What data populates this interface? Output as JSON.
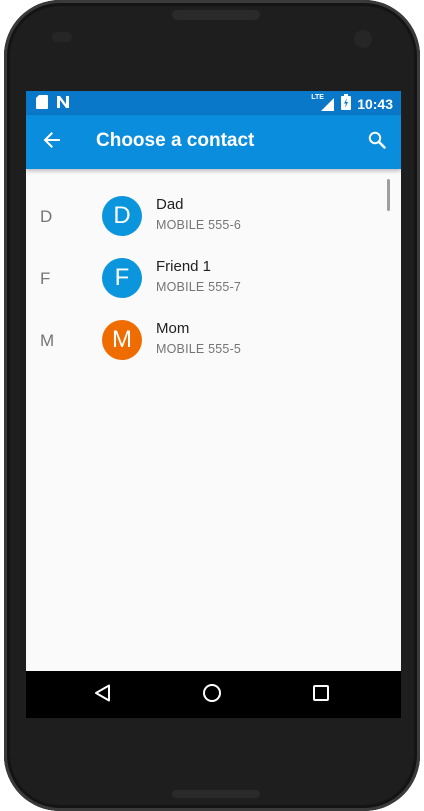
{
  "status_bar": {
    "time": "10:43",
    "network_label": "LTE",
    "left_icons": [
      "sd-card-icon",
      "nfc-n-icon"
    ],
    "right_icons": [
      "signal-icon",
      "battery-icon"
    ]
  },
  "app_bar": {
    "title": "Choose a contact",
    "back_icon": "arrow-back-icon",
    "search_icon": "search-icon",
    "color": "#0a8ddd"
  },
  "contacts": [
    {
      "section": "D",
      "initial": "D",
      "name": "Dad",
      "phone": "MOBILE 555-6",
      "avatar_color": "#0a95dd"
    },
    {
      "section": "F",
      "initial": "F",
      "name": "Friend 1",
      "phone": "MOBILE 555-7",
      "avatar_color": "#0a95dd"
    },
    {
      "section": "M",
      "initial": "M",
      "name": "Mom",
      "phone": "MOBILE 555-5",
      "avatar_color": "#ef6c00"
    }
  ],
  "nav_bar": {
    "icons": [
      "back-triangle-icon",
      "home-circle-icon",
      "recents-square-icon"
    ]
  },
  "colors": {
    "status_bar": "#0a78c8",
    "app_bar": "#0a8ddd",
    "background": "#fafafa"
  }
}
